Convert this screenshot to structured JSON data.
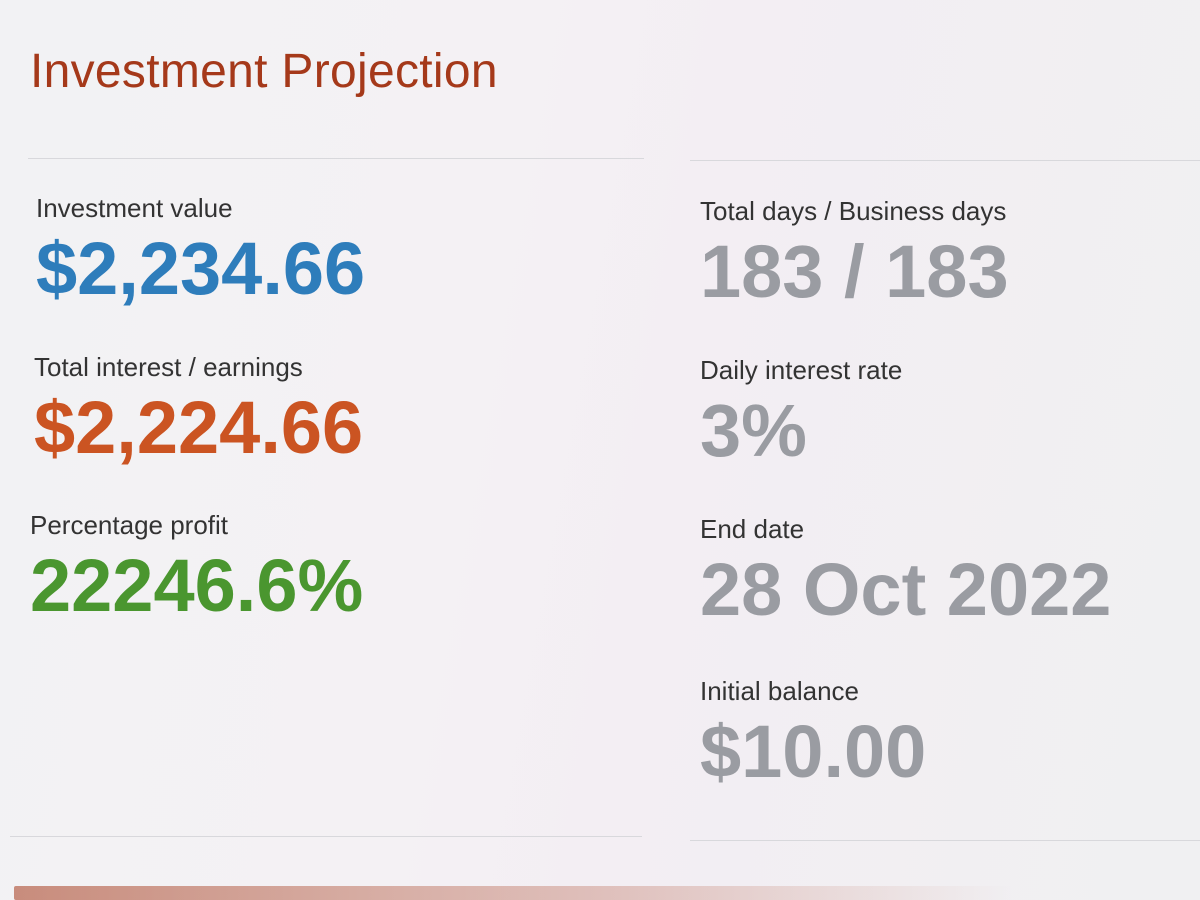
{
  "header": {
    "title": "Investment Projection"
  },
  "left_stats": [
    {
      "label": "Investment value",
      "value": "$2,234.66",
      "color": "#2e7dbb"
    },
    {
      "label": "Total interest / earnings",
      "value": "$2,224.66",
      "color": "#cb5422"
    },
    {
      "label": "Percentage profit",
      "value": "22246.6%",
      "color": "#4a962f"
    }
  ],
  "right_stats": [
    {
      "label": "Total days / Business days",
      "value": "183 / 183",
      "color": "#9a9ca2"
    },
    {
      "label": "Daily interest rate",
      "value": "3%",
      "color": "#9a9ca2"
    },
    {
      "label": "End date",
      "value": "28 Oct 2022",
      "color": "#9a9ca2"
    },
    {
      "label": "Initial balance",
      "value": "$10.00",
      "color": "#9a9ca2"
    }
  ],
  "theme": {
    "title_color": "#a5391a",
    "label_color": "#333333"
  }
}
